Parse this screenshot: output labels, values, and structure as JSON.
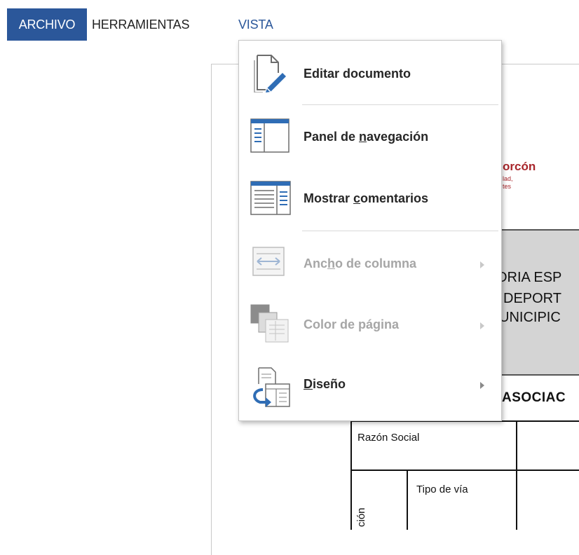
{
  "menubar": {
    "tabs": [
      {
        "label": "ARCHIVO",
        "active": true
      },
      {
        "label": "HERRAMIENTAS",
        "active": false
      },
      {
        "label": "VISTA",
        "active": false,
        "open": true
      }
    ]
  },
  "vista_menu": {
    "items": [
      {
        "label": "Editar documento",
        "icon": "edit-document-icon",
        "enabled": true,
        "submenu": false
      },
      {
        "label": "Panel de navegación",
        "icon": "navigation-pane-icon",
        "enabled": true,
        "submenu": false
      },
      {
        "label": "Mostrar comentarios",
        "icon": "show-comments-icon",
        "enabled": true,
        "submenu": false
      },
      {
        "label": "Ancho de columna",
        "icon": "column-width-icon",
        "enabled": false,
        "submenu": true
      },
      {
        "label": "Color de página",
        "icon": "page-color-icon",
        "enabled": false,
        "submenu": true
      },
      {
        "label": "Diseño",
        "icon": "layout-icon",
        "enabled": true,
        "submenu": true
      }
    ]
  },
  "document": {
    "logo_name": "orcón",
    "logo_sub_1": "lad,",
    "logo_sub_2": "tes",
    "heading_lines": [
      "ORIA ESP",
      "DEPORT",
      "UNICIPIC"
    ],
    "section_title": "ASOCIAC",
    "table": {
      "razon_social": "Razón Social",
      "tipo_via": "Tipo de vía",
      "vertical_label": "ción"
    }
  },
  "colors": {
    "accent": "#2b579a",
    "logo": "#a8262b",
    "disabled_text": "#a6a6a6"
  }
}
